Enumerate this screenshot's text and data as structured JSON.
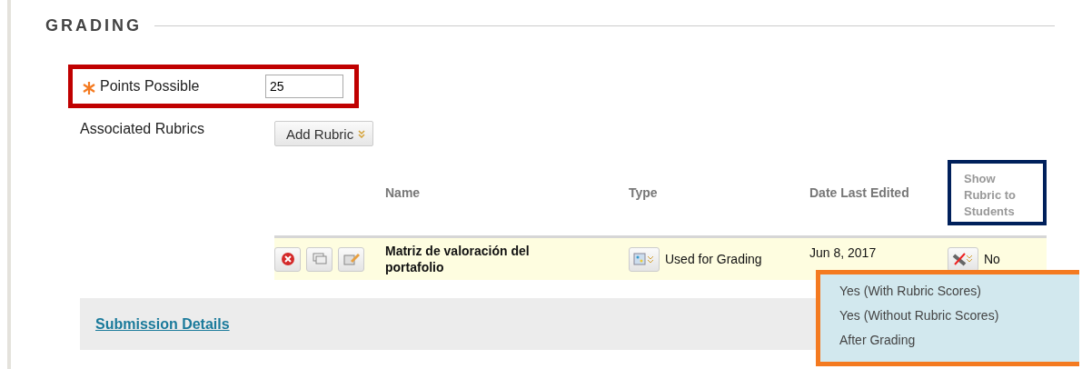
{
  "section": {
    "title": "GRADING"
  },
  "points": {
    "label": "Points Possible",
    "value": "25",
    "required": true
  },
  "rubrics": {
    "label": "Associated Rubrics",
    "button": "Add Rubric"
  },
  "table": {
    "columns": [
      "Name",
      "Type",
      "Date Last Edited",
      "Show Rubric to Students"
    ],
    "rows": [
      {
        "name": "Matriz de valoración del portafolio",
        "type": "Used for Grading",
        "date": "Jun 8, 2017",
        "show": "No"
      }
    ]
  },
  "menu": {
    "items": [
      "Yes (With Rubric Scores)",
      "Yes (Without Rubric Scores)",
      "After Grading"
    ]
  },
  "submission": {
    "link": "Submission Details"
  }
}
